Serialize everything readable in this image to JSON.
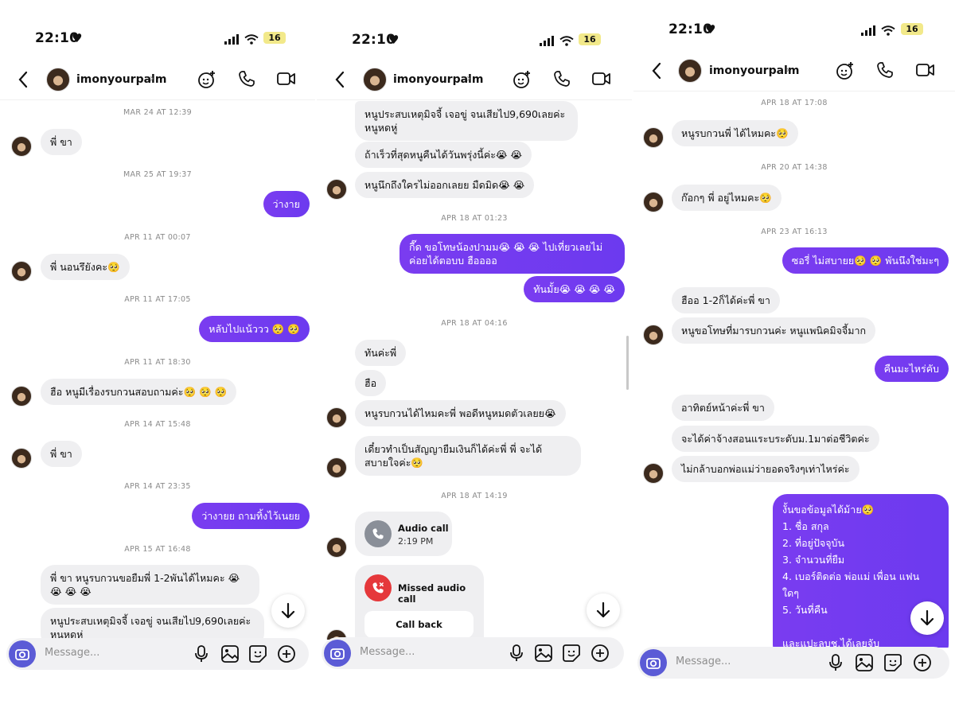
{
  "screens": [
    {
      "status": {
        "time": "22:10",
        "battery": "16"
      },
      "header": {
        "username": "imonyourpalm"
      },
      "composer": {
        "placeholder": "Message..."
      },
      "items": [
        {
          "kind": "ts",
          "text": "MAR 24 AT 12:39"
        },
        {
          "kind": "in",
          "text": "พี่     ขา"
        },
        {
          "kind": "ts",
          "text": "MAR 25 AT 19:37"
        },
        {
          "kind": "out",
          "text": "ว่างาย"
        },
        {
          "kind": "ts",
          "text": "APR 11 AT 00:07"
        },
        {
          "kind": "in",
          "text": "พี่     นอนรึยังคะ🥺"
        },
        {
          "kind": "ts",
          "text": "APR 11 AT 17:05"
        },
        {
          "kind": "out",
          "text": "หลับไปแน้ววว 🥺 🥺"
        },
        {
          "kind": "ts",
          "text": "APR 11 AT 18:30"
        },
        {
          "kind": "in",
          "text": "ฮือ หนูมีเรื่องรบกวนสอบถามค่ะ🥺 🥺 🥺"
        },
        {
          "kind": "ts",
          "text": "APR 14 AT 15:48"
        },
        {
          "kind": "in",
          "text": "พี่     ขา"
        },
        {
          "kind": "ts",
          "text": "APR 14 AT 23:35"
        },
        {
          "kind": "out",
          "text": "ว่างายย ถามทิ้งไว้เนยย"
        },
        {
          "kind": "ts",
          "text": "APR 15 AT 16:48"
        },
        {
          "kind": "in",
          "text": "พี่     ขา หนูรบกวนขอยืมพี่     1-2พันได้ไหมคะ 😭 😭 😭 😭"
        },
        {
          "kind": "in",
          "text": "หนูประสบเหตุมิจจี้ เจอขู่ จนเสียไป9,690เลยค่ะ หนูหดหู่"
        }
      ]
    },
    {
      "status": {
        "time": "22:10",
        "battery": "16"
      },
      "header": {
        "username": "imonyourpalm"
      },
      "composer": {
        "placeholder": "Message..."
      },
      "items": [
        {
          "kind": "in",
          "text": "หนูประสบเหตุมิจจี้ เจอขู่ จนเสียไป9,690เลยค่ะ หนูหดหู่"
        },
        {
          "kind": "in",
          "text": "ถ้าเร็วที่สุดหนูคืนได้วันพรุ่งนี้ค่ะ😭 😭"
        },
        {
          "kind": "in",
          "text": "หนูนึกถึงใครไม่ออกเลยย มืดมิด😭 😭"
        },
        {
          "kind": "ts",
          "text": "APR 18 AT 01:23"
        },
        {
          "kind": "out",
          "text": "กี๊ด ขอโทษน้องปามม😭 😭 😭 ไปเที่ยวเลยไม่ค่อยได้ตอบบ ฮืออออ"
        },
        {
          "kind": "out",
          "text": "ทันมั้ย😭 😭 😭 😭"
        },
        {
          "kind": "ts",
          "text": "APR 18 AT 04:16"
        },
        {
          "kind": "in",
          "text": "ทันค่ะพี่"
        },
        {
          "kind": "in",
          "text": "ฮือ"
        },
        {
          "kind": "in",
          "text": "หนูรบกวนได้ไหมคะพี่     พอดีหนูหมดตัวเลยย😭"
        },
        {
          "kind": "in",
          "text": "เดี๋ยวทำเป็นสัญญายืมเงินก็ได้ค่ะพี่     พี่     จะได้สบายใจค่ะ🥺"
        },
        {
          "kind": "ts",
          "text": "APR 18 AT 14:19"
        },
        {
          "kind": "call",
          "title": "Audio call",
          "sub": "2:19 PM"
        },
        {
          "kind": "missed",
          "title": "Missed audio call",
          "button": "Call back"
        }
      ]
    },
    {
      "status": {
        "time": "22:10",
        "battery": "16"
      },
      "header": {
        "username": "imonyourpalm"
      },
      "composer": {
        "placeholder": "Message..."
      },
      "items": [
        {
          "kind": "ts",
          "text": "APR 18 AT 17:08"
        },
        {
          "kind": "in",
          "text": "หนูรบกวนพี่     ได้ไหมคะ🥺"
        },
        {
          "kind": "ts",
          "text": "APR 20 AT 14:38"
        },
        {
          "kind": "in",
          "text": "ก๊อกๆ พี่     อยู่ไหมคะ🥺"
        },
        {
          "kind": "ts",
          "text": "APR 23 AT 16:13"
        },
        {
          "kind": "out",
          "text": "ซอรี่ ไม่สบายย🥺 🥺 พันนึงใช่มะๆ"
        },
        {
          "kind": "in",
          "text": "ฮืออ 1-2ก็ได้ค่ะพี่     ขา"
        },
        {
          "kind": "in",
          "text": "หนูขอโทษที่มารบกวนค่ะ หนูแพนิคมิจจี้มาก"
        },
        {
          "kind": "out",
          "text": "คืนมะไหร่คับ"
        },
        {
          "kind": "in",
          "text": "อาทิตย์หน้าค่ะพี่     ขา"
        },
        {
          "kind": "in",
          "text": "จะได้ค่าจ้างสอนแระบระดับม.1มาต่อชีวิตค่ะ"
        },
        {
          "kind": "in",
          "text": "ไม่กล้าบอกพ่อแม่ว่ายอดจริงๆเท่าไหร่ค่ะ"
        },
        {
          "kind": "outlist",
          "intro": "งั้นขอข้อมูลได้ม้าย🥺",
          "lines": [
            "1.  ชื่อ สกุล",
            "2.  ที่อยู่ปัจจุบัน",
            "3.  จำนวนที่ยืม",
            "4.  เบอร์ติดต่อ พ่อแม่ เพื่อน แฟน ใดๆ",
            "5.  วันที่คืน"
          ],
          "outro": "และแปะลบช.ได้เลยจับ"
        }
      ]
    }
  ]
}
